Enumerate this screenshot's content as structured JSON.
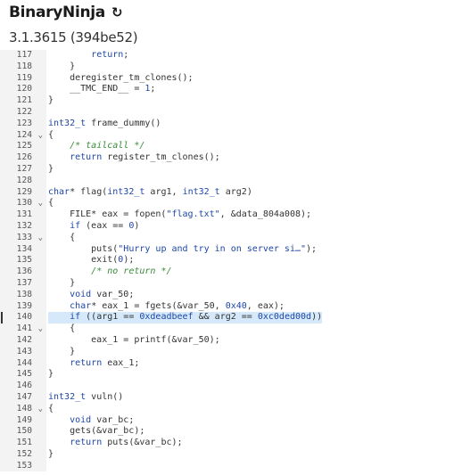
{
  "header": {
    "app_title": "BinaryNinja",
    "refresh_icon_glyph": "↻",
    "version": "3.1.3615 (394be52)"
  },
  "editor": {
    "highlight_color": "#d6e9fb",
    "keyword_color": "#1f47a6",
    "comment_color": "#3a8c3a",
    "lines": [
      {
        "n": "117",
        "fold": false,
        "hl": false,
        "tokens": [
          [
            "        ",
            ""
          ],
          [
            "return",
            "kw"
          ],
          [
            ";",
            ""
          ]
        ]
      },
      {
        "n": "118",
        "fold": false,
        "hl": false,
        "tokens": [
          [
            "    }",
            ""
          ]
        ]
      },
      {
        "n": "119",
        "fold": false,
        "hl": false,
        "tokens": [
          [
            "    deregister_tm_clones();",
            ""
          ]
        ]
      },
      {
        "n": "120",
        "fold": false,
        "hl": false,
        "tokens": [
          [
            "    __TMC_END__ = ",
            ""
          ],
          [
            "1",
            "num-lit"
          ],
          [
            ";",
            ""
          ]
        ]
      },
      {
        "n": "121",
        "fold": false,
        "hl": false,
        "tokens": [
          [
            "}",
            ""
          ]
        ]
      },
      {
        "n": "122",
        "fold": false,
        "hl": false,
        "tokens": []
      },
      {
        "n": "123",
        "fold": false,
        "hl": false,
        "tokens": [
          [
            "int32_t",
            "ty"
          ],
          [
            " frame_dummy()",
            ""
          ]
        ]
      },
      {
        "n": "124",
        "fold": true,
        "hl": false,
        "tokens": [
          [
            "{",
            ""
          ]
        ]
      },
      {
        "n": "125",
        "fold": false,
        "hl": false,
        "tokens": [
          [
            "    ",
            ""
          ],
          [
            "/* tailcall */",
            "cm"
          ]
        ]
      },
      {
        "n": "126",
        "fold": false,
        "hl": false,
        "tokens": [
          [
            "    ",
            ""
          ],
          [
            "return",
            "kw"
          ],
          [
            " register_tm_clones();",
            ""
          ]
        ]
      },
      {
        "n": "127",
        "fold": false,
        "hl": false,
        "tokens": [
          [
            "}",
            ""
          ]
        ]
      },
      {
        "n": "128",
        "fold": false,
        "hl": false,
        "tokens": []
      },
      {
        "n": "129",
        "fold": false,
        "hl": false,
        "tokens": [
          [
            "char",
            "ty"
          ],
          [
            "* flag(",
            ""
          ],
          [
            "int32_t",
            "ty"
          ],
          [
            " arg1, ",
            ""
          ],
          [
            "int32_t",
            "ty"
          ],
          [
            " arg2)",
            ""
          ]
        ]
      },
      {
        "n": "130",
        "fold": true,
        "hl": false,
        "tokens": [
          [
            "{",
            ""
          ]
        ]
      },
      {
        "n": "131",
        "fold": false,
        "hl": false,
        "tokens": [
          [
            "    FILE* eax = fopen(",
            ""
          ],
          [
            "\"flag.txt\"",
            "str"
          ],
          [
            ", &data_804a008);",
            ""
          ]
        ]
      },
      {
        "n": "132",
        "fold": false,
        "hl": false,
        "tokens": [
          [
            "    ",
            ""
          ],
          [
            "if",
            "kw"
          ],
          [
            " (eax == ",
            ""
          ],
          [
            "0",
            "num-lit"
          ],
          [
            ")",
            ""
          ]
        ]
      },
      {
        "n": "133",
        "fold": true,
        "hl": false,
        "tokens": [
          [
            "    {",
            ""
          ]
        ]
      },
      {
        "n": "134",
        "fold": false,
        "hl": false,
        "tokens": [
          [
            "        puts(",
            ""
          ],
          [
            "\"Hurry up and try in on server si…\"",
            "str"
          ],
          [
            ");",
            ""
          ]
        ]
      },
      {
        "n": "135",
        "fold": false,
        "hl": false,
        "tokens": [
          [
            "        exit(",
            ""
          ],
          [
            "0",
            "num-lit"
          ],
          [
            ");",
            ""
          ]
        ]
      },
      {
        "n": "136",
        "fold": false,
        "hl": false,
        "tokens": [
          [
            "        ",
            ""
          ],
          [
            "/* no return */",
            "cm"
          ]
        ]
      },
      {
        "n": "137",
        "fold": false,
        "hl": false,
        "tokens": [
          [
            "    }",
            ""
          ]
        ]
      },
      {
        "n": "138",
        "fold": false,
        "hl": false,
        "tokens": [
          [
            "    ",
            ""
          ],
          [
            "void",
            "ty"
          ],
          [
            " var_50;",
            ""
          ]
        ]
      },
      {
        "n": "139",
        "fold": false,
        "hl": false,
        "tokens": [
          [
            "    ",
            ""
          ],
          [
            "char",
            "ty"
          ],
          [
            "* eax_1 = fgets(&var_50, ",
            ""
          ],
          [
            "0x40",
            "num-lit"
          ],
          [
            ", eax);",
            ""
          ]
        ]
      },
      {
        "n": "140",
        "fold": false,
        "hl": true,
        "tokens": [
          [
            "    ",
            ""
          ],
          [
            "if",
            "kw"
          ],
          [
            " ((arg1 == ",
            ""
          ],
          [
            "0xdeadbeef",
            "num-lit"
          ],
          [
            " && arg2 == ",
            ""
          ],
          [
            "0xc0ded00d",
            "num-lit"
          ],
          [
            "))",
            ""
          ]
        ]
      },
      {
        "n": "141",
        "fold": true,
        "hl": false,
        "tokens": [
          [
            "    {",
            ""
          ]
        ]
      },
      {
        "n": "142",
        "fold": false,
        "hl": false,
        "tokens": [
          [
            "        eax_1 = printf(&var_50);",
            ""
          ]
        ]
      },
      {
        "n": "143",
        "fold": false,
        "hl": false,
        "tokens": [
          [
            "    }",
            ""
          ]
        ]
      },
      {
        "n": "144",
        "fold": false,
        "hl": false,
        "tokens": [
          [
            "    ",
            ""
          ],
          [
            "return",
            "kw"
          ],
          [
            " eax_1;",
            ""
          ]
        ]
      },
      {
        "n": "145",
        "fold": false,
        "hl": false,
        "tokens": [
          [
            "}",
            ""
          ]
        ]
      },
      {
        "n": "146",
        "fold": false,
        "hl": false,
        "tokens": []
      },
      {
        "n": "147",
        "fold": false,
        "hl": false,
        "tokens": [
          [
            "int32_t",
            "ty"
          ],
          [
            " vuln()",
            ""
          ]
        ]
      },
      {
        "n": "148",
        "fold": true,
        "hl": false,
        "tokens": [
          [
            "{",
            ""
          ]
        ]
      },
      {
        "n": "149",
        "fold": false,
        "hl": false,
        "tokens": [
          [
            "    ",
            ""
          ],
          [
            "void",
            "ty"
          ],
          [
            " var_bc;",
            ""
          ]
        ]
      },
      {
        "n": "150",
        "fold": false,
        "hl": false,
        "tokens": [
          [
            "    gets(&var_bc);",
            ""
          ]
        ]
      },
      {
        "n": "151",
        "fold": false,
        "hl": false,
        "tokens": [
          [
            "    ",
            ""
          ],
          [
            "return",
            "kw"
          ],
          [
            " puts(&var_bc);",
            ""
          ]
        ]
      },
      {
        "n": "152",
        "fold": false,
        "hl": false,
        "tokens": [
          [
            "}",
            ""
          ]
        ]
      },
      {
        "n": "153",
        "fold": false,
        "hl": false,
        "tokens": []
      }
    ]
  }
}
